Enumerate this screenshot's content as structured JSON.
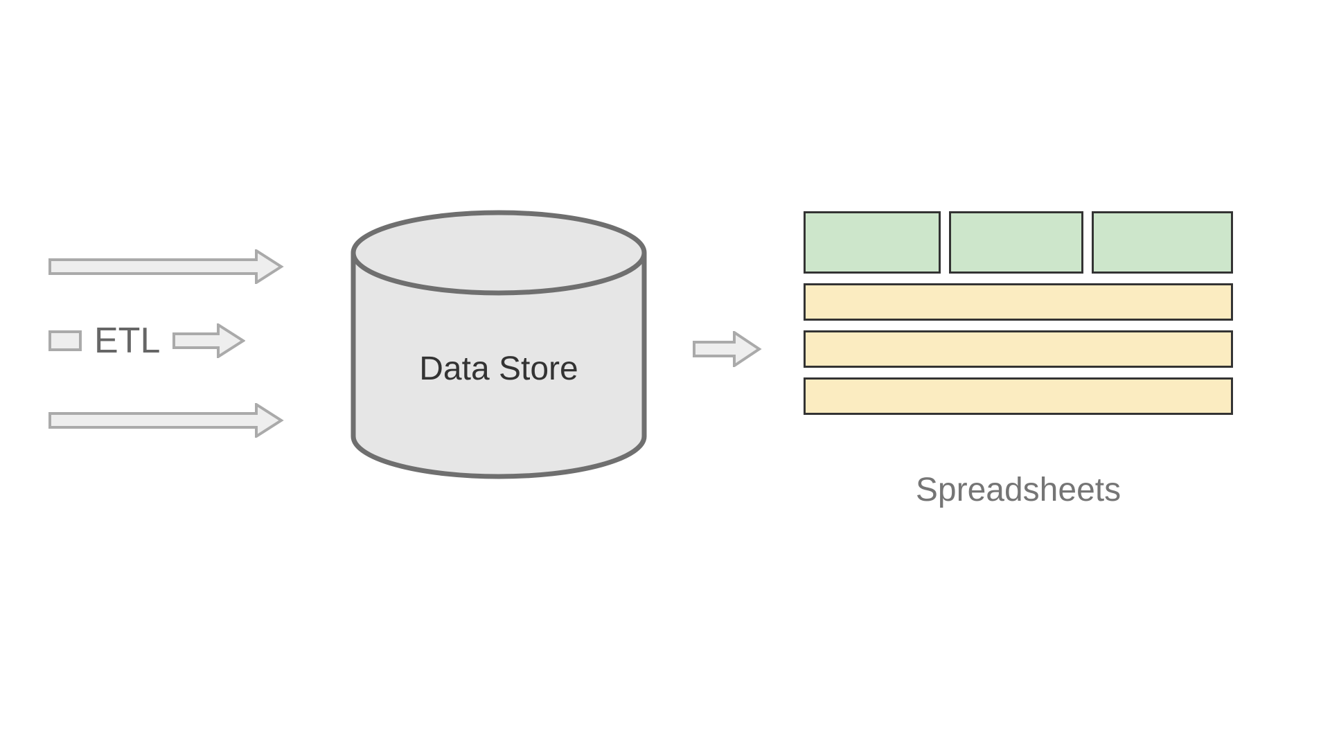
{
  "diagram": {
    "etl_label": "ETL",
    "datastore_label": "Data Store",
    "spreadsheets_label": "Spreadsheets",
    "colors": {
      "arrow_fill": "#eeeeee",
      "arrow_stroke": "#aaaaaa",
      "cylinder_fill": "#e6e6e6",
      "cylinder_stroke": "#6f6f6f",
      "tab_fill": "#cde6cb",
      "row_fill": "#fbecc1",
      "block_stroke": "#333333"
    },
    "flow": [
      "etl_inputs",
      "data_store",
      "spreadsheets_output"
    ]
  }
}
